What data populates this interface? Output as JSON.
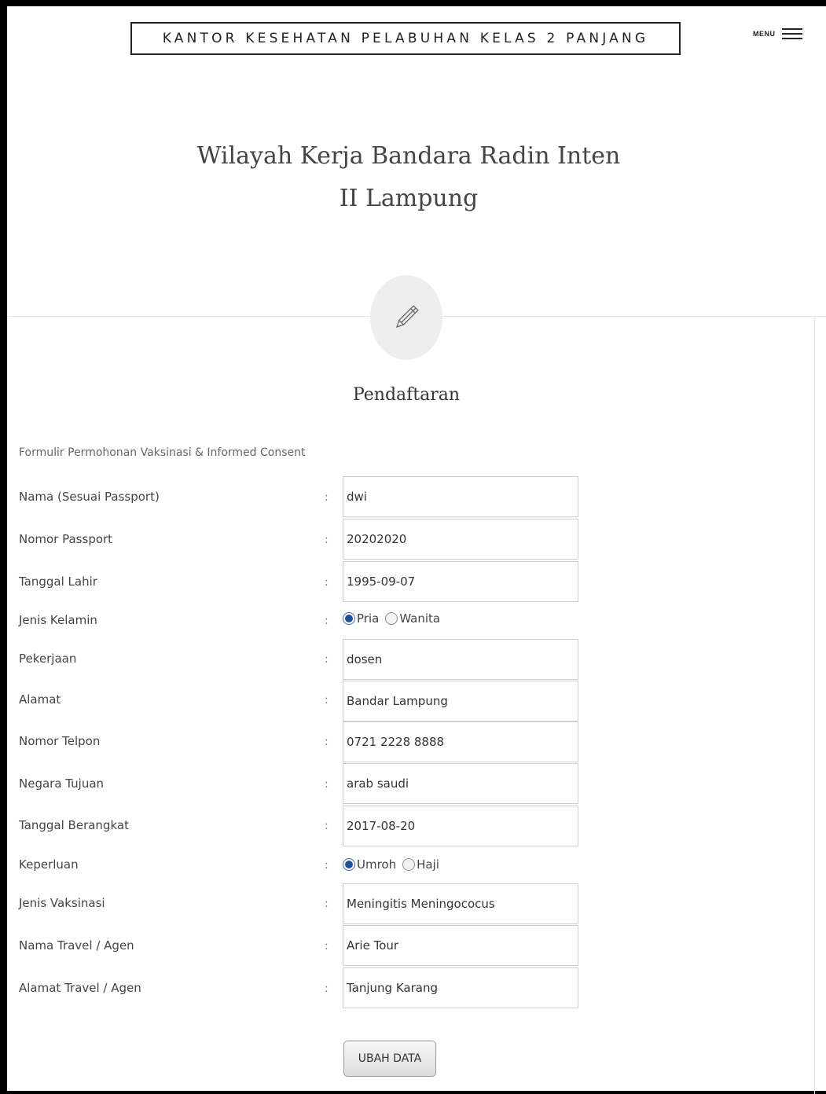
{
  "header": {
    "brand": "KANTOR KESEHATAN PELABUHAN KELAS 2 PANJANG",
    "menu_label": "MENU",
    "menu_icon": "hamburger-icon"
  },
  "headline": {
    "line1": "Wilayah Kerja Bandara Radin Inten",
    "line2": "II Lampung"
  },
  "section": {
    "icon": "pencil-icon",
    "title": "Pendaftaran",
    "caption": "Formulir Permohonan Vaksinasi & Informed Consent"
  },
  "form": {
    "colon": ":",
    "nama": {
      "label": "Nama (Sesuai Passport)",
      "value": "dwi"
    },
    "passport": {
      "label": "Nomor Passport",
      "value": "20202020"
    },
    "tanggal_lahir": {
      "label": "Tanggal Lahir",
      "value": "1995-09-07"
    },
    "jenis_kelamin": {
      "label": "Jenis Kelamin",
      "options": [
        "Pria",
        "Wanita"
      ],
      "selected": "Pria"
    },
    "pekerjaan": {
      "label": "Pekerjaan",
      "value": "dosen"
    },
    "alamat": {
      "label": "Alamat",
      "value": "Bandar Lampung"
    },
    "telpon": {
      "label": "Nomor Telpon",
      "value": "0721 2228 8888"
    },
    "negara": {
      "label": "Negara Tujuan",
      "value": "arab saudi"
    },
    "berangkat": {
      "label": "Tanggal Berangkat",
      "value": "2017-08-20"
    },
    "keperluan": {
      "label": "Keperluan",
      "options": [
        "Umroh",
        "Haji"
      ],
      "selected": "Umroh"
    },
    "vaksinasi": {
      "label": "Jenis Vaksinasi",
      "value": "Meningitis Meningococus"
    },
    "travel": {
      "label": "Nama Travel / Agen",
      "value": "Arie Tour"
    },
    "travel_alamat": {
      "label": "Alamat Travel / Agen",
      "value": "Tanjung Karang"
    },
    "submit_label": "UBAH DATA"
  }
}
